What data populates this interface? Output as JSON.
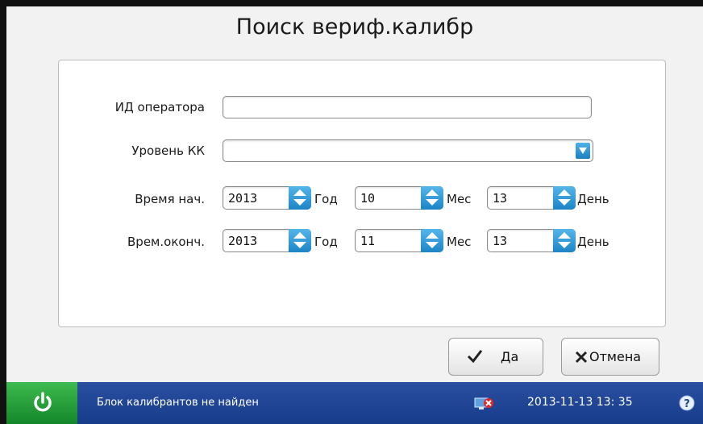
{
  "dialog": {
    "title": "Поиск вериф.калибр"
  },
  "form": {
    "operator_label": "ИД оператора",
    "operator_value": "",
    "level_label": "Уровень КК",
    "level_value": "",
    "start_label": "Время нач.",
    "end_label": "Врем.оконч.",
    "start": {
      "year": "2013",
      "month": "10",
      "day": "13"
    },
    "end": {
      "year": "2013",
      "month": "11",
      "day": "13"
    },
    "year_unit": "Год",
    "month_unit": "Мес",
    "day_unit": "День"
  },
  "buttons": {
    "ok": "Да",
    "cancel": "Отмена"
  },
  "status": {
    "message": "Блок калибрантов не найден",
    "datetime": "2013-11-13  13: 35"
  },
  "icons": {
    "power": "power-icon",
    "dropdown": "chevron-down-icon",
    "spinner": "spinner-arrows-icon",
    "ok": "check-icon",
    "cancel": "close-icon",
    "network": "network-error-icon",
    "help": "help-icon"
  },
  "colors": {
    "status_bar": "#1f4595",
    "power_button": "#2aa63f",
    "spinner_accent": "#2b8fd0"
  }
}
